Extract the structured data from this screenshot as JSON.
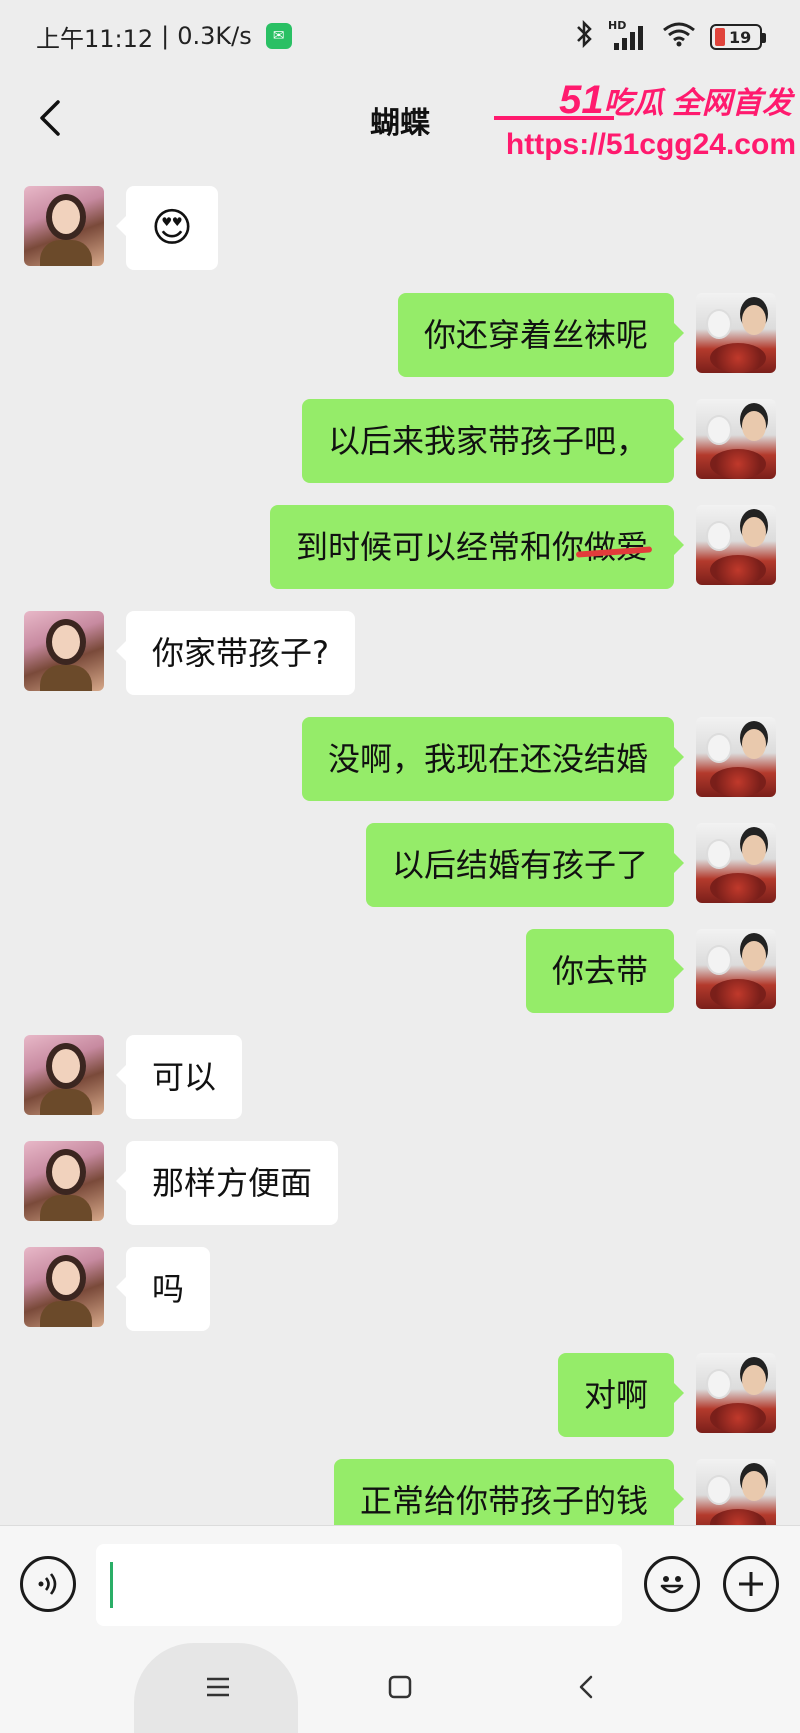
{
  "status_bar": {
    "time": "上午11:12",
    "separator": "|",
    "network_speed": "0.3K/s",
    "signal_label": "HD",
    "battery_level": "19",
    "battery_color": "#e0443c"
  },
  "nav": {
    "title": "蝴蝶",
    "back_icon": "chevron-left-icon"
  },
  "watermark": {
    "brand_number": "51",
    "brand_text": "吃瓜 全网首发",
    "url": "https://51cgg24.com",
    "color": "#ff1a6e"
  },
  "colors": {
    "incoming_bubble": "#ffffff",
    "outgoing_bubble": "#95ec69",
    "background": "#ededed"
  },
  "messages": [
    {
      "side": "in",
      "text": "😍"
    },
    {
      "side": "out",
      "text": "你还穿着丝袜呢"
    },
    {
      "side": "out",
      "text": "以后来我家带孩子吧，"
    },
    {
      "side": "out",
      "text": "到时候可以经常和你做爱"
    },
    {
      "side": "in",
      "text": "你家带孩子?"
    },
    {
      "side": "out",
      "text": "没啊，我现在还没结婚"
    },
    {
      "side": "out",
      "text": "以后结婚有孩子了"
    },
    {
      "side": "out",
      "text": "你去带"
    },
    {
      "side": "in",
      "text": "可以"
    },
    {
      "side": "in",
      "text": "那样方便面"
    },
    {
      "side": "in",
      "text": "吗"
    },
    {
      "side": "out",
      "text": "对啊"
    },
    {
      "side": "out",
      "text": "正常给你带孩子的钱"
    }
  ],
  "input_bar": {
    "voice_icon": "voice-icon",
    "emoji_icon": "emoji-icon",
    "plus_icon": "plus-icon",
    "value": ""
  },
  "system_nav": {
    "menu_icon": "menu-icon",
    "home_icon": "home-square-icon",
    "back_icon": "back-triangle-icon"
  }
}
